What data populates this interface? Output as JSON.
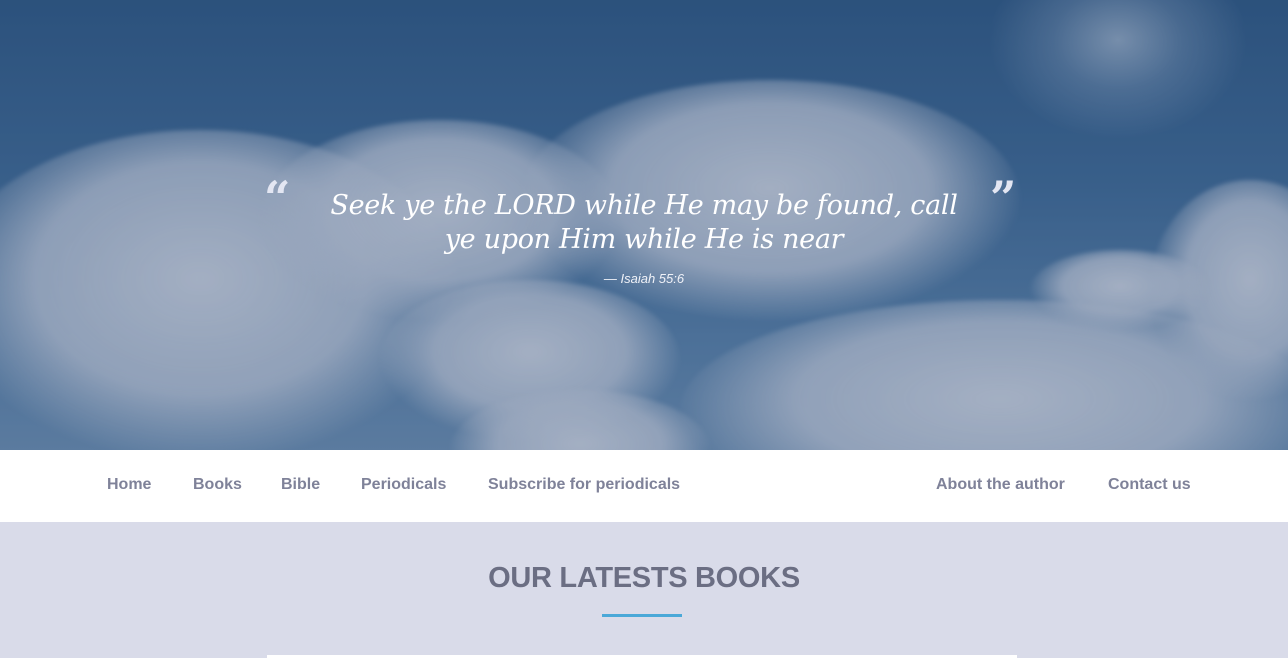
{
  "hero": {
    "quote_open": "“",
    "quote_close": "”",
    "quote_text": "Seek ye the LORD while He may be found, call ye upon Him while He is near",
    "citation": "— Isaiah 55:6"
  },
  "nav": {
    "left": [
      "Home",
      "Books",
      "Bible",
      "Periodicals",
      "Subscribe for periodicals"
    ],
    "right": [
      "About the author",
      "Contact us"
    ]
  },
  "latest": {
    "heading": "OUR LATESTS BOOKS"
  },
  "colors": {
    "nav_text": "#7f8299",
    "section_bg": "#d9dbe9",
    "heading": "#6b6e83",
    "accent": "#4aa8d8"
  }
}
